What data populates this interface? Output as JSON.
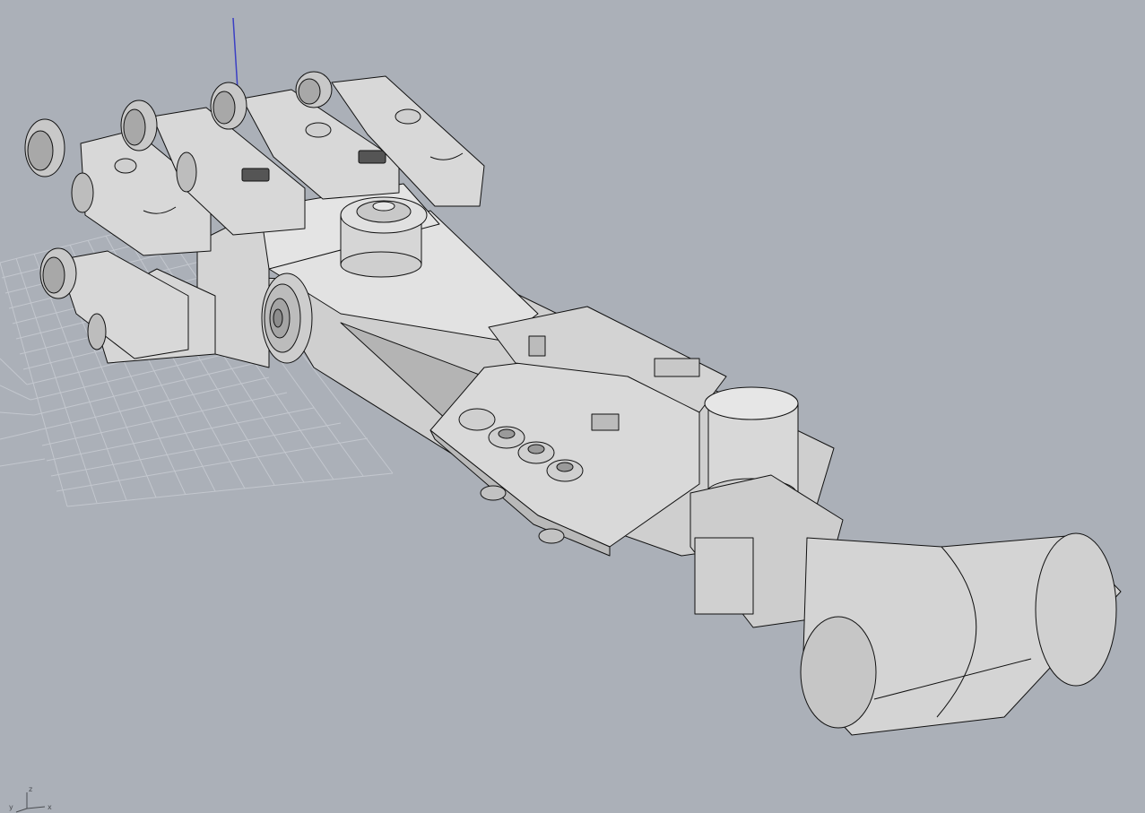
{
  "viewport": {
    "background": "#abb0b8",
    "grid_color": "#c3c7ce",
    "model_fill": "#d8d8d8",
    "model_shade": "#bdbdbd",
    "model_dark": "#9a9a9a",
    "edge_color": "#111111",
    "z_axis_color": "#3b3fc4"
  },
  "axis_widget": {
    "x_label": "x",
    "y_label": "y",
    "z_label": "z"
  }
}
